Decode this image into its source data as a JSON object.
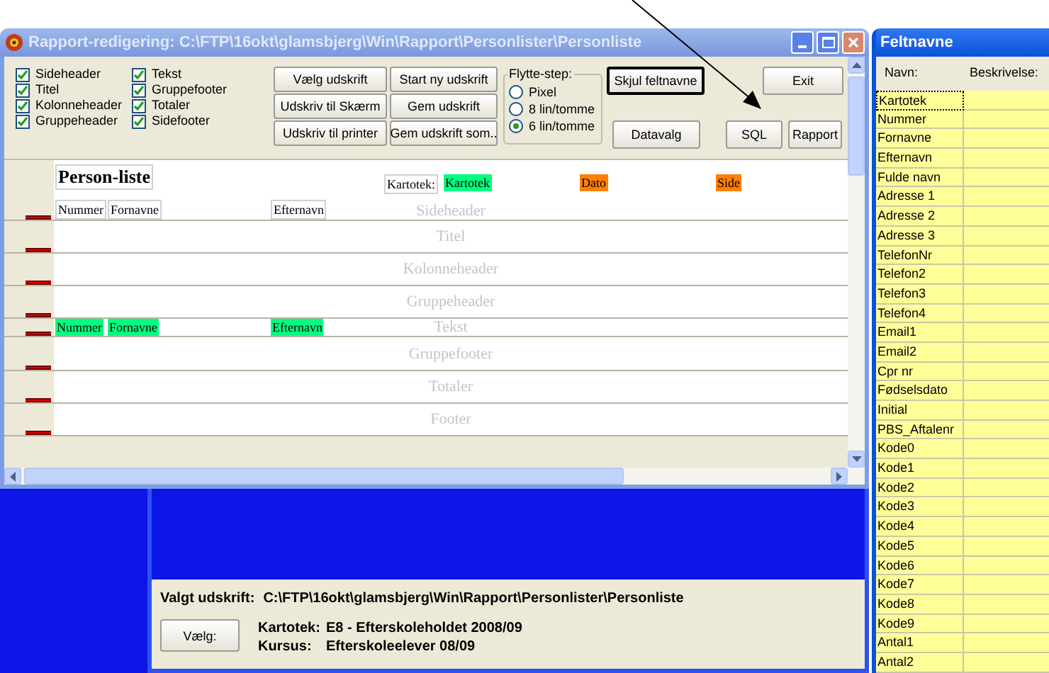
{
  "main_window": {
    "title": "Rapport-redigering: C:\\FTP\\16okt\\glamsbjerg\\Win\\Rapport\\Personlister\\Personliste",
    "sections": [
      {
        "label": "Sideheader",
        "checked": true
      },
      {
        "label": "Titel",
        "checked": true
      },
      {
        "label": "Kolonneheader",
        "checked": true
      },
      {
        "label": "Gruppeheader",
        "checked": true
      },
      {
        "label": "Tekst",
        "checked": true
      },
      {
        "label": "Gruppefooter",
        "checked": true
      },
      {
        "label": "Totaler",
        "checked": true
      },
      {
        "label": "Sidefooter",
        "checked": true
      }
    ],
    "print_buttons": [
      "Vælg udskrift",
      "Udskriv til Skærm",
      "Udskriv til printer"
    ],
    "save_buttons": [
      "Start ny udskrift",
      "Gem udskrift",
      "Gem udskrift som.."
    ],
    "move_step": {
      "title": "Flytte-step:",
      "options": [
        {
          "label": "Pixel",
          "selected": false
        },
        {
          "label": "8 lin/tomme",
          "selected": false
        },
        {
          "label": "6 lin/tomme",
          "selected": true
        }
      ]
    },
    "hide_fields_button": {
      "label": "Skjul feltnavne",
      "focused": true
    },
    "exit_button": "Exit",
    "bottom_buttons": [
      "Datavalg",
      "SQL",
      "Rapport"
    ],
    "report": {
      "title": "Person-liste",
      "bands": [
        {
          "label": "Sideheader",
          "fields": [
            {
              "text": "Kartotek:",
              "kind": "label"
            },
            {
              "text": "Kartotek",
              "kind": "field"
            },
            {
              "text": "Dato",
              "kind": "system"
            },
            {
              "text": "Side",
              "kind": "system"
            },
            {
              "text": "Nummer",
              "kind": "label"
            },
            {
              "text": "Fornavne",
              "kind": "label"
            },
            {
              "text": "Efternavn",
              "kind": "label"
            }
          ]
        },
        {
          "label": "Titel"
        },
        {
          "label": "Kolonneheader"
        },
        {
          "label": "Gruppeheader"
        },
        {
          "label": "Tekst",
          "fields": [
            {
              "text": "Nummer",
              "kind": "field"
            },
            {
              "text": "Fornavne",
              "kind": "field"
            },
            {
              "text": "Efternavn",
              "kind": "field"
            }
          ]
        },
        {
          "label": "Gruppefooter"
        },
        {
          "label": "Totaler"
        },
        {
          "label": "Footer"
        }
      ]
    }
  },
  "selection_panel": {
    "label": "Valgt udskrift:",
    "path": "C:\\FTP\\16okt\\glamsbjerg\\Win\\Rapport\\Personlister\\Personliste",
    "button": "Vælg:",
    "info": [
      {
        "label": "Kartotek:",
        "value": "E8 - Efterskoleholdet 2008/09"
      },
      {
        "label": "Kursus:",
        "value": "Efterskoleelever 08/09"
      }
    ]
  },
  "field_window": {
    "title": "Feltnavne",
    "columns": [
      "Navn:",
      "Beskrivelse:"
    ],
    "rows": [
      {
        "name": "Kartotek",
        "selected": true
      },
      {
        "name": "Nummer",
        "selected": false
      },
      {
        "name": "Fornavne",
        "selected": false
      },
      {
        "name": "Efternavn",
        "selected": false
      },
      {
        "name": "Fulde navn",
        "selected": false
      },
      {
        "name": "Adresse 1",
        "selected": false
      },
      {
        "name": "Adresse 2",
        "selected": false
      },
      {
        "name": "Adresse 3",
        "selected": false
      },
      {
        "name": "TelefonNr",
        "selected": false
      },
      {
        "name": "Telefon2",
        "selected": false
      },
      {
        "name": "Telefon3",
        "selected": false
      },
      {
        "name": "Telefon4",
        "selected": false
      },
      {
        "name": "Email1",
        "selected": false
      },
      {
        "name": "Email2",
        "selected": false
      },
      {
        "name": "Cpr nr",
        "selected": false
      },
      {
        "name": "Fødselsdato",
        "selected": false
      },
      {
        "name": "Initial",
        "selected": false
      },
      {
        "name": "PBS_Aftalenr",
        "selected": false
      },
      {
        "name": "Kode0",
        "selected": false
      },
      {
        "name": "Kode1",
        "selected": false
      },
      {
        "name": "Kode2",
        "selected": false
      },
      {
        "name": "Kode3",
        "selected": false
      },
      {
        "name": "Kode4",
        "selected": false
      },
      {
        "name": "Kode5",
        "selected": false
      },
      {
        "name": "Kode6",
        "selected": false
      },
      {
        "name": "Kode7",
        "selected": false
      },
      {
        "name": "Kode8",
        "selected": false
      },
      {
        "name": "Kode9",
        "selected": false
      },
      {
        "name": "Antal1",
        "selected": false
      },
      {
        "name": "Antal2",
        "selected": false
      }
    ]
  }
}
